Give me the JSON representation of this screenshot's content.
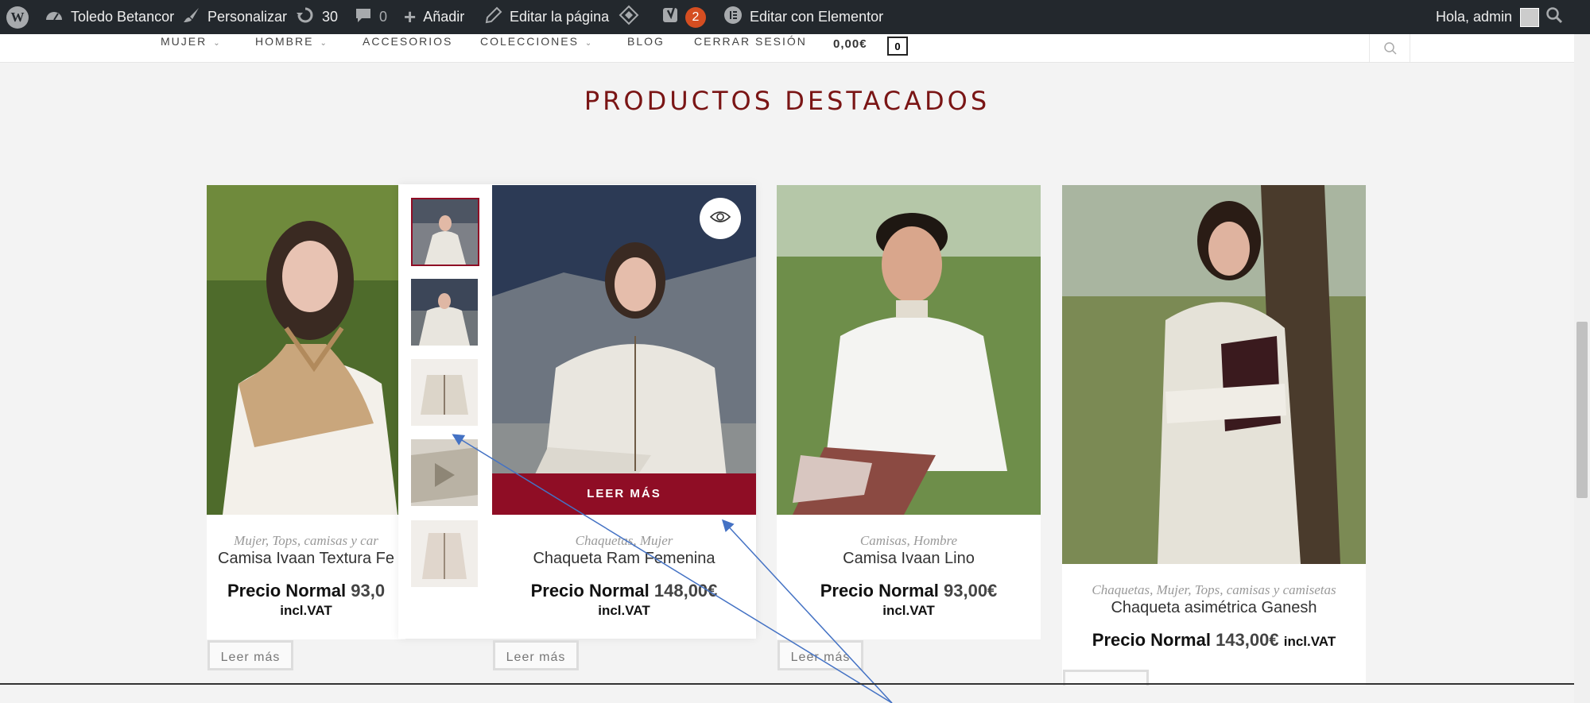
{
  "adminbar": {
    "site_name": "Toledo Betancor",
    "customize": "Personalizar",
    "updates": "30",
    "comments": "0",
    "add_new": "Añadir",
    "edit_page": "Editar la página",
    "yoast_badge": "2",
    "elementor": "Editar con Elementor",
    "greeting": "Hola, admin"
  },
  "nav": {
    "items": [
      {
        "label": "MUJER",
        "has_sub": true
      },
      {
        "label": "HOMBRE",
        "has_sub": true
      },
      {
        "label": "ACCESORIOS",
        "has_sub": false
      },
      {
        "label": "COLECCIONES",
        "has_sub": true
      },
      {
        "label": "BLOG",
        "has_sub": false
      },
      {
        "label": "CERRAR SESIÓN",
        "has_sub": false
      }
    ],
    "cart_total": "0,00€",
    "cart_count": "0"
  },
  "section_title": "PRODUCTOS DESTACADOS",
  "products": [
    {
      "categories": "Mujer, Tops, camisas y car",
      "name": "Camisa Ivaan Textura Fe",
      "price_label": "Precio Normal",
      "price": "93,0",
      "vat": "incl.VAT",
      "button": "Leer más"
    },
    {
      "categories": "Chaquetas, Mujer",
      "name": "Chaqueta Ram Femenina",
      "price_label": "Precio Normal",
      "price": "148,00€",
      "vat": "incl.VAT",
      "button": "Leer más",
      "hover_cta": "LEER MÁS"
    },
    {
      "categories": "Camisas, Hombre",
      "name": "Camisa Ivaan Lino",
      "price_label": "Precio Normal",
      "price": "93,00€",
      "vat": "incl.VAT",
      "button": "Leer más"
    },
    {
      "categories": "Chaquetas, Mujer, Tops, camisas y camisetas",
      "name": "Chaqueta asimétrica Ganesh",
      "price_label": "Precio Normal",
      "price": "143,00€",
      "vat": "incl.VAT"
    }
  ],
  "colors": {
    "brand": "#8f0d25",
    "title": "#7a1515",
    "adminbar": "#23282d"
  },
  "icons": [
    "wordpress-icon",
    "dashboard-icon",
    "brush-icon",
    "updates-icon",
    "comment-icon",
    "plus-icon",
    "pencil-icon",
    "diamond-icon",
    "yoast-icon",
    "elementor-icon",
    "search-icon",
    "eye-icon"
  ]
}
